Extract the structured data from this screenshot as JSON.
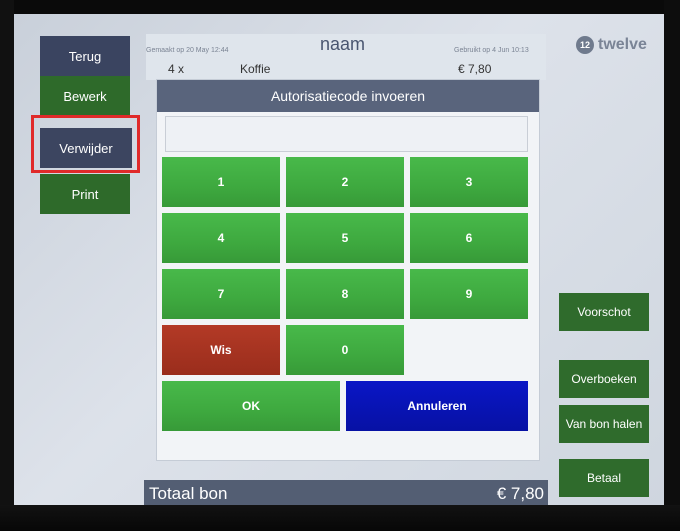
{
  "left_buttons": {
    "terug": "Terug",
    "bewerk": "Bewerk",
    "verwijder": "Verwijder",
    "print": "Print"
  },
  "header": {
    "name": "naam",
    "created": "Gemaakt op 20 May 12:44",
    "used": "Gebruikt op 4 Jun 10:13",
    "line_qty": "4 x",
    "line_item": "Koffie",
    "line_price": "€ 7,80"
  },
  "logo": {
    "icon": "12",
    "text": "twelve"
  },
  "dialog": {
    "title": "Autorisatiecode invoeren",
    "code_value": "",
    "keys": [
      "1",
      "2",
      "3",
      "4",
      "5",
      "6",
      "7",
      "8",
      "9",
      "Wis",
      "0"
    ],
    "ok": "OK",
    "cancel": "Annuleren"
  },
  "total": {
    "label": "Totaal bon",
    "value": "€ 7,80"
  },
  "right_buttons": {
    "voorschot": "Voorschot",
    "overboeken": "Overboeken",
    "van_bon_halen": "Van bon halen",
    "betaal": "Betaal"
  },
  "colors": {
    "green_key": "#3ea93f",
    "red_key": "#a7301f",
    "blue_key": "#0a16c6",
    "dialog_title": "#59647c",
    "highlight": "#e02a2a"
  }
}
